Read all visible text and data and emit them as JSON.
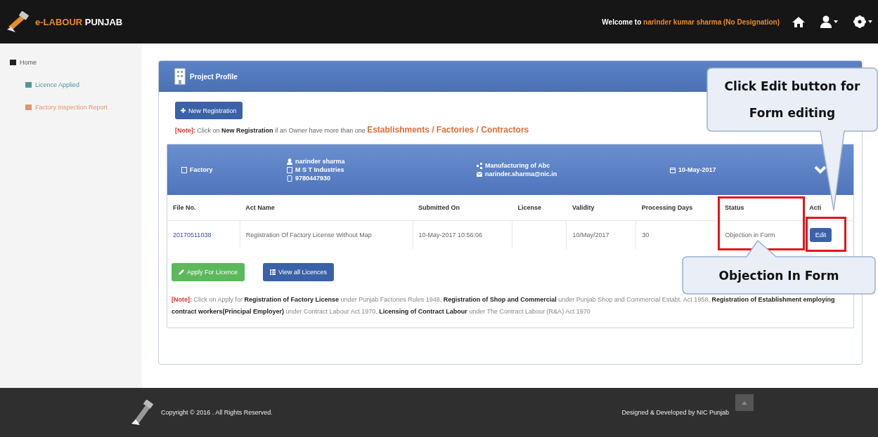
{
  "header": {
    "logo_prefix": "e-LABOUR",
    "logo_suffix": "PUNJAB",
    "welcome_prefix": "Welcome to",
    "welcome_name": "narinder kumar sharma (No Designation)"
  },
  "sidebar": {
    "items": [
      {
        "label": "Home",
        "children": [
          {
            "label": "Licence Applied",
            "color": "#4f9a9e"
          },
          {
            "label": "Factory Inspection Report",
            "color": "#e0956a"
          }
        ]
      }
    ]
  },
  "panel": {
    "title": "Project Profile",
    "new_registration_button": "New Registration",
    "note": [
      {
        "kind": "label",
        "text": "[Note]:"
      },
      {
        "kind": "plain",
        "text": "Click on"
      },
      {
        "kind": "bold",
        "text": "New Registration"
      },
      {
        "kind": "plain",
        "text": "if an Owner have more than one"
      },
      {
        "kind": "highlight",
        "text": "Establishments / Factories / Contractors"
      }
    ],
    "profile": {
      "type": "Factory",
      "owner": "narinder sharma",
      "company": "M S T Industries",
      "phone": "9780447930",
      "activity": "Manufacturing of Abc",
      "email": "narinder.sharma@nic.in",
      "date": "10-May-2017"
    },
    "table": {
      "columns": [
        "File No.",
        "Act Name",
        "Submitted On",
        "License",
        "Validity",
        "Processing Days",
        "Status",
        "Acti"
      ],
      "rows": [
        {
          "file_no": "20170511038",
          "act_name": "Registration Of Factory License Without Map",
          "submitted_on": "10-May-2017 10:56:06",
          "validity": "10/May/2017",
          "processing_days": "30",
          "status": "Objection in Form",
          "action": "Edit"
        }
      ]
    },
    "apply_button": "Apply For Licence",
    "view_button": "View all Licences",
    "footnote": [
      {
        "kind": "label",
        "text": "[Note]:"
      },
      {
        "kind": "plain",
        "text": "Click on Apply for"
      },
      {
        "kind": "bold",
        "text": "Registration of Factory License"
      },
      {
        "kind": "plain",
        "text": "under Punjab Factories Rules 1948,"
      },
      {
        "kind": "bold",
        "text": "Registration of Shop and Commercial"
      },
      {
        "kind": "plain",
        "text": "under Punjab Shop and Commercial Estabt. Act 1958,"
      },
      {
        "kind": "bold",
        "text": "Registration of Establishment employing contract workers(Principal Employer)"
      },
      {
        "kind": "plain",
        "text": "under Contract Labour Act 1970,"
      },
      {
        "kind": "bold",
        "text": "Licensing of Contract Labour"
      },
      {
        "kind": "plain",
        "text": "under The Contract Labour (R&A) Act 1970"
      }
    ]
  },
  "footer": {
    "copyright": "Copyright © 2016 . All Rights Reserved.",
    "credit": "Designed & Developed by NIC Punjab"
  },
  "callouts": [
    {
      "kind": "down",
      "text": "Click Edit button for Form editing"
    },
    {
      "kind": "up",
      "text": "Objection In Form"
    }
  ]
}
